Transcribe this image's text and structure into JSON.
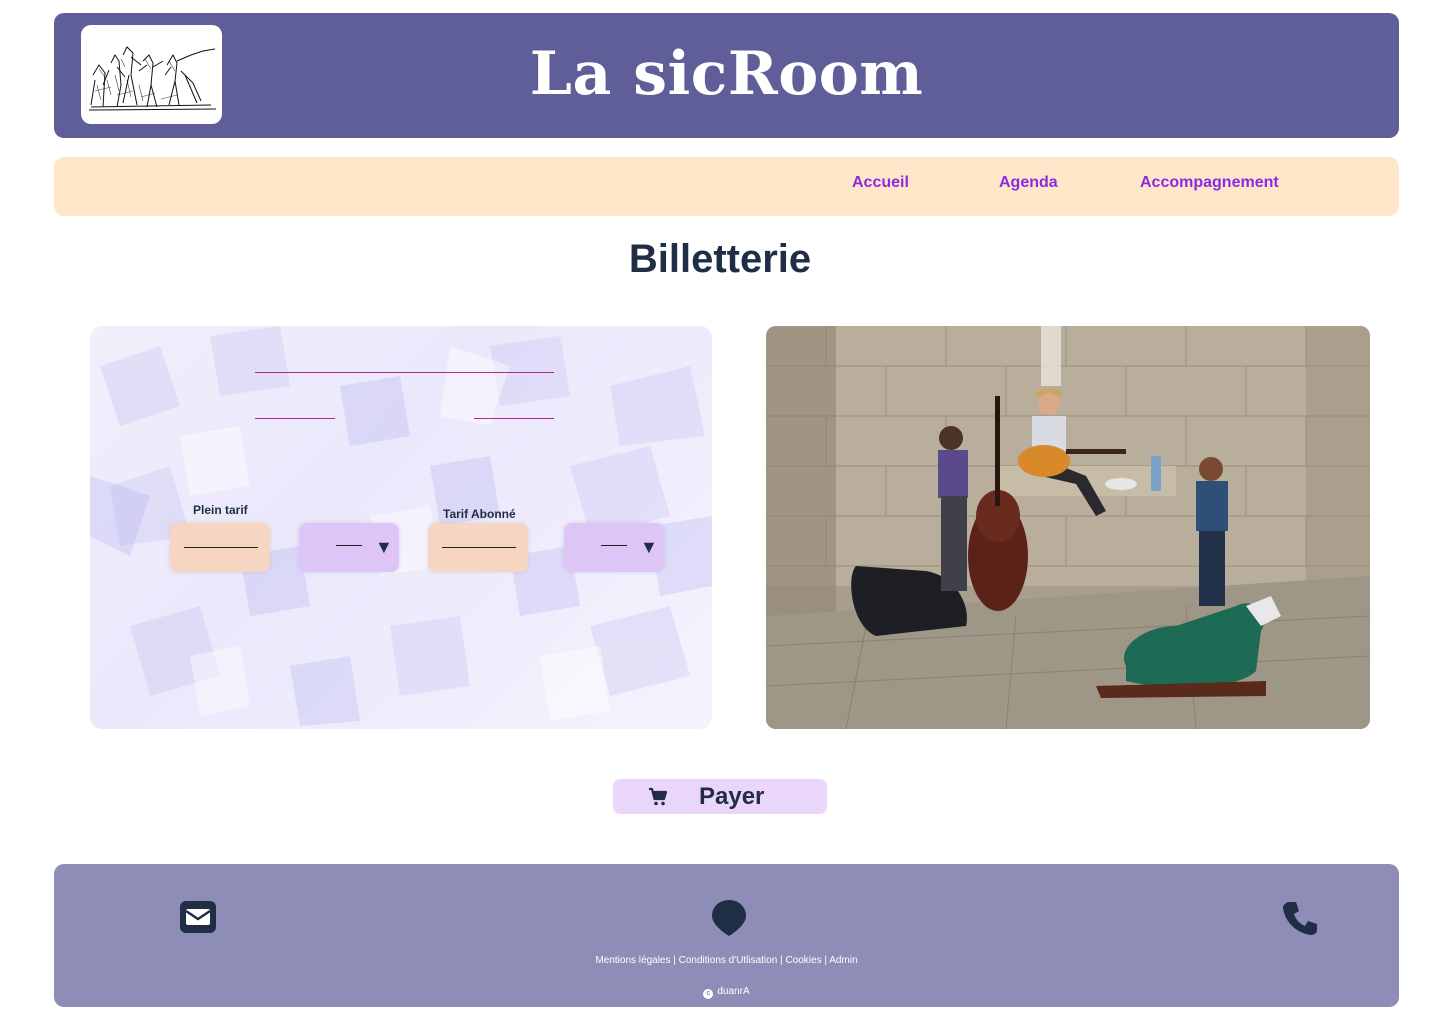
{
  "header": {
    "site_title": "La sicRoom",
    "logo_icon": "sketch-dancers-logo"
  },
  "nav": {
    "items": [
      {
        "label": "Accueil"
      },
      {
        "label": "Agenda"
      },
      {
        "label": "Accompagnement"
      }
    ]
  },
  "main": {
    "title": "Billetterie",
    "ticket_form": {
      "full_price_label": "Plein tarif",
      "subscriber_price_label": "Tarif Abonné",
      "full_price_quantity": "",
      "subscriber_price_quantity": "",
      "dropdown_icon": "triangle-down-icon"
    },
    "photo_alt": "Trio de musiciens dans une salle en pierre"
  },
  "pay_button": {
    "label": "Payer",
    "icon": "cart-icon"
  },
  "footer": {
    "icons": [
      "envelope-icon",
      "map-pin-icon",
      "phone-icon"
    ],
    "links": [
      "Mentions légales",
      "Conditions d'Utlisation",
      "Cookies",
      "Admin"
    ],
    "separator": " | ",
    "copyright_name": "duanrA",
    "copyright_icon": "copyright-icon"
  },
  "colors": {
    "header_bg": "#5f5e99",
    "nav_bg": "#ffe6c8",
    "nav_link": "#8a2be2",
    "title_text": "#1f2d45",
    "footer_bg": "#8e8db8",
    "pay_button_bg": "#ead6f8"
  }
}
